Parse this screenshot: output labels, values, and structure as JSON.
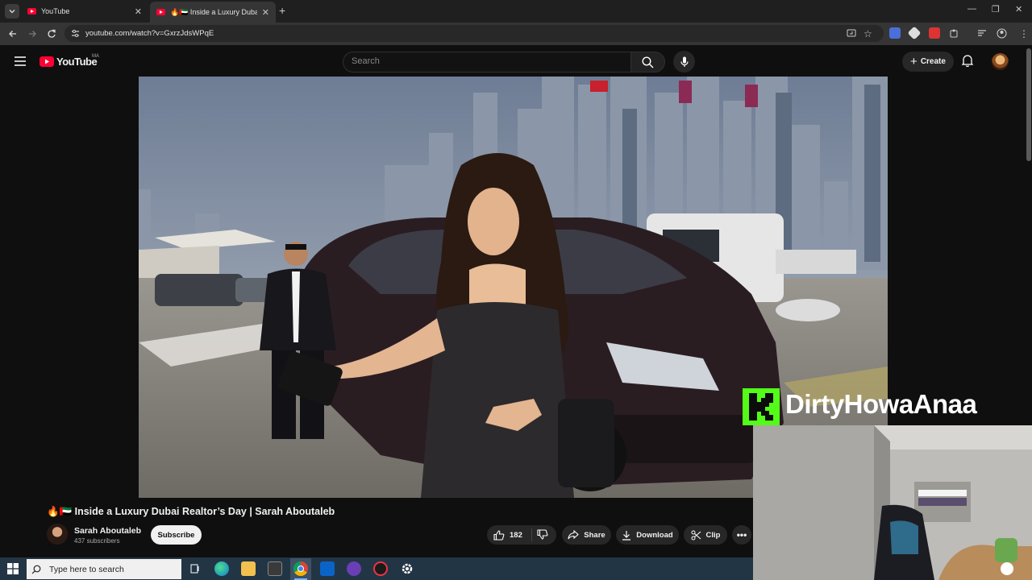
{
  "browser": {
    "tabs": [
      {
        "title": "YouTube",
        "active": false
      },
      {
        "title": "🔥🇦🇪 Inside a Luxury Dubai Realtor's Day",
        "active": true
      }
    ],
    "url": "youtube.com/watch?v=GxrzJdsWPqE"
  },
  "youtube": {
    "logo_text": "YouTube",
    "region_code": "MA",
    "search_placeholder": "Search",
    "create_label": "Create"
  },
  "video": {
    "title": "🔥🇦🇪 Inside a Luxury Dubai Realtor’s Day | Sarah Aboutaleb",
    "channel": "Sarah Aboutaleb",
    "subscribers": "437 subscribers",
    "subscribe_label": "Subscribe",
    "likes": "182",
    "share_label": "Share",
    "download_label": "Download",
    "clip_label": "Clip"
  },
  "overlay": {
    "streamer_name": "DirtyHowaAnaa",
    "kick_color": "#53fc18"
  },
  "taskbar": {
    "search_placeholder": "Type here to search",
    "color": "#223545"
  }
}
